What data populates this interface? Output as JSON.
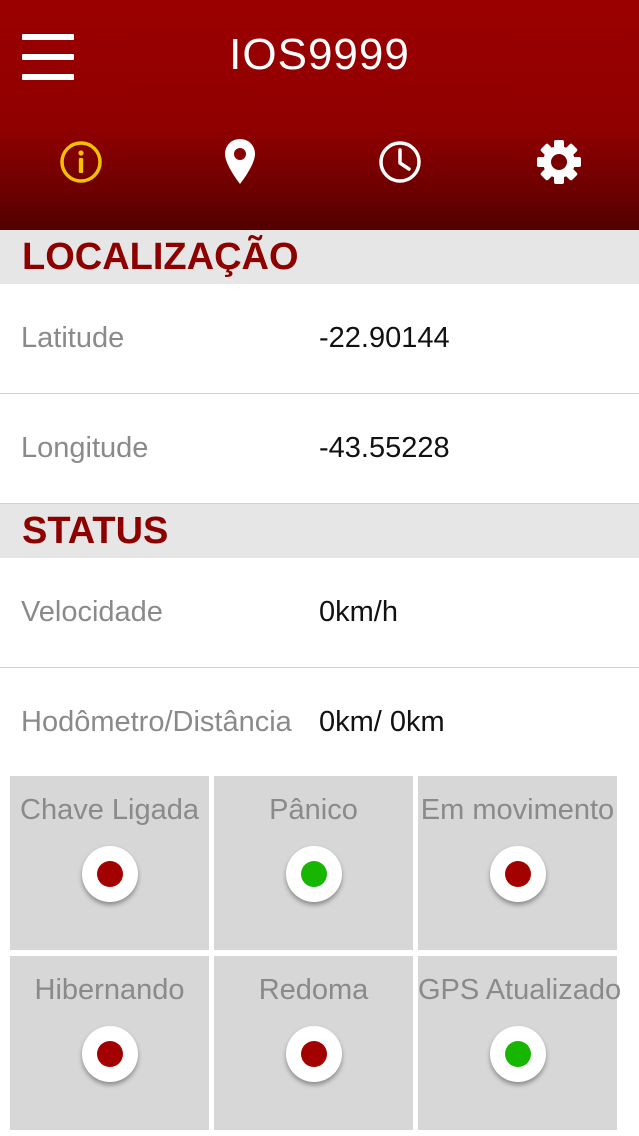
{
  "header": {
    "title": "IOS9999",
    "tabs": [
      {
        "icon": "info-icon",
        "active": true,
        "color": "#f2c200"
      },
      {
        "icon": "map-pin-icon",
        "active": false,
        "color": "#ffffff"
      },
      {
        "icon": "clock-icon",
        "active": false,
        "color": "#ffffff"
      },
      {
        "icon": "gear-icon",
        "active": false,
        "color": "#ffffff"
      }
    ]
  },
  "location": {
    "title": "LOCALIZAÇÃO",
    "latitude_label": "Latitude",
    "latitude_value": "-22.90144",
    "longitude_label": "Longitude",
    "longitude_value": "-43.55228"
  },
  "status": {
    "title": "STATUS",
    "speed_label": "Velocidade",
    "speed_value": "0km/h",
    "odometer_label": "Hodômetro/Distância",
    "odometer_value": "0km/ 0km"
  },
  "indicators": [
    {
      "label": "Chave Ligada",
      "state": "red"
    },
    {
      "label": "Pânico",
      "state": "green"
    },
    {
      "label": "Em movimento",
      "state": "red"
    },
    {
      "label": "Hibernando",
      "state": "red"
    },
    {
      "label": "Redoma",
      "state": "red"
    },
    {
      "label": "GPS Atualizado",
      "state": "green"
    }
  ],
  "colors": {
    "brand": "#900000",
    "section_title": "#8e0000",
    "indicator_red": "#a30000",
    "indicator_green": "#17b600"
  }
}
